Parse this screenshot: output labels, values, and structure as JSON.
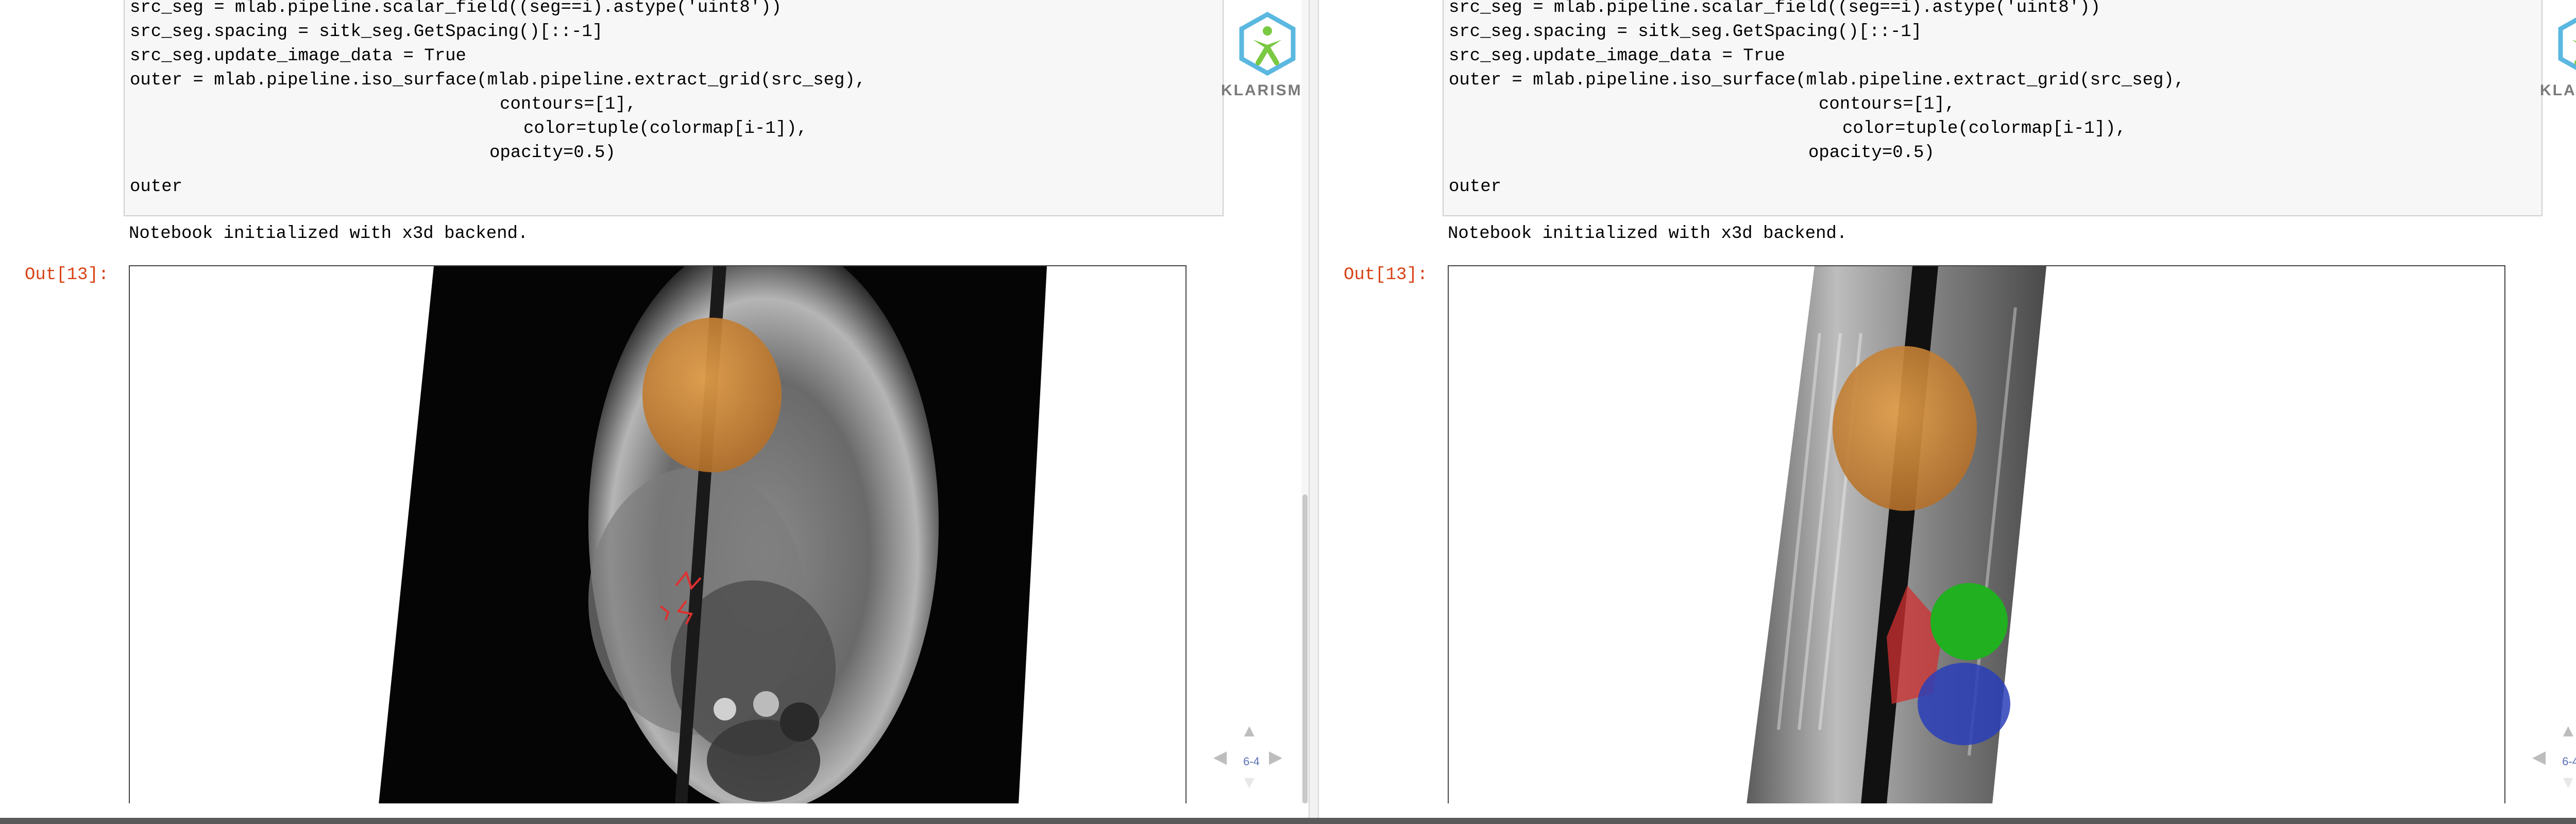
{
  "code_lines": [
    "src_seg = mlab.pipeline.scalar_field((seg==i).astype('uint8'))",
    "src_seg.spacing = sitk_seg.GetSpacing()[::-1]",
    "src_seg.update_image_data = True",
    "outer = mlab.pipeline.iso_surface(mlab.pipeline.extract_grid(src_seg),",
    "contours=[1],",
    "color=tuple(colormap[i-1]),",
    "opacity=0.5)"
  ],
  "code_last_line": "outer",
  "stream_output": "Notebook initialized with x3d backend.",
  "out_prompt": "Out[13]:",
  "logo": {
    "name": "KLARISMO",
    "color": "#5bb8e0",
    "figure_color": "#7ac943"
  },
  "nav": {
    "slide_number": "6-4",
    "up": "▲",
    "down": "▼",
    "left": "◀",
    "right": "▶"
  },
  "panes": [
    {
      "id": "left",
      "view": "axial-oblique",
      "segment_colors": [
        "#e49a3c",
        "#e03030"
      ]
    },
    {
      "id": "right",
      "view": "sagittal-oblique",
      "segment_colors": [
        "#e49a3c",
        "#e03030",
        "#22b222",
        "#2244cc"
      ]
    }
  ]
}
